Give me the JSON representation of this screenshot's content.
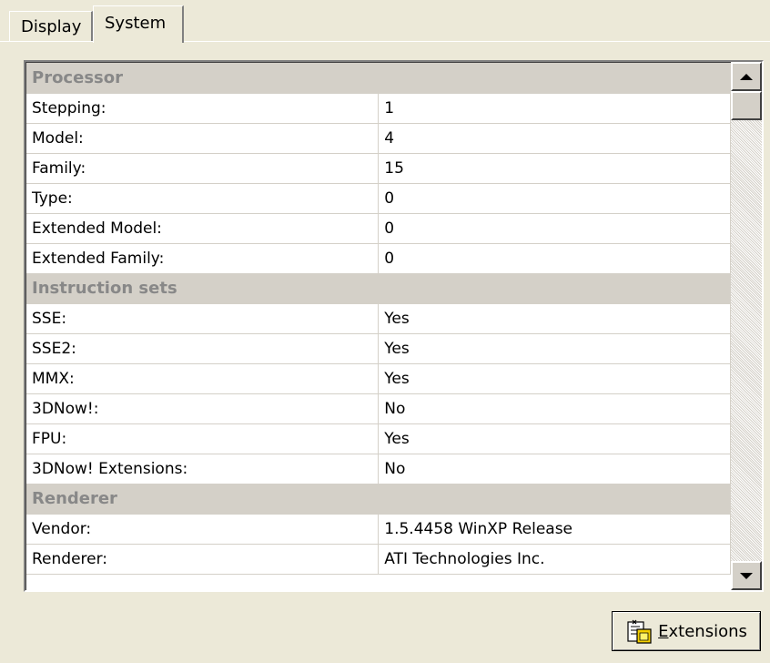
{
  "tabs": {
    "display_label": "Display",
    "system_label": "System"
  },
  "sections": [
    {
      "title": "Processor",
      "rows": [
        {
          "label": "Stepping:",
          "value": "1"
        },
        {
          "label": "Model:",
          "value": "4"
        },
        {
          "label": "Family:",
          "value": "15"
        },
        {
          "label": "Type:",
          "value": "0"
        },
        {
          "label": "Extended Model:",
          "value": "0"
        },
        {
          "label": "Extended Family:",
          "value": "0"
        }
      ]
    },
    {
      "title": "Instruction sets",
      "rows": [
        {
          "label": "SSE:",
          "value": "Yes"
        },
        {
          "label": "SSE2:",
          "value": "Yes"
        },
        {
          "label": "MMX:",
          "value": "Yes"
        },
        {
          "label": "3DNow!:",
          "value": "No"
        },
        {
          "label": "FPU:",
          "value": "Yes"
        },
        {
          "label": "3DNow! Extensions:",
          "value": "No"
        }
      ]
    },
    {
      "title": "Renderer",
      "rows": [
        {
          "label": "Vendor:",
          "value": "1.5.4458 WinXP Release"
        },
        {
          "label": "Renderer:",
          "value": "ATI Technologies Inc."
        }
      ]
    }
  ],
  "extensions_button": {
    "label": "Extensions",
    "icon": "extensions-icon"
  }
}
